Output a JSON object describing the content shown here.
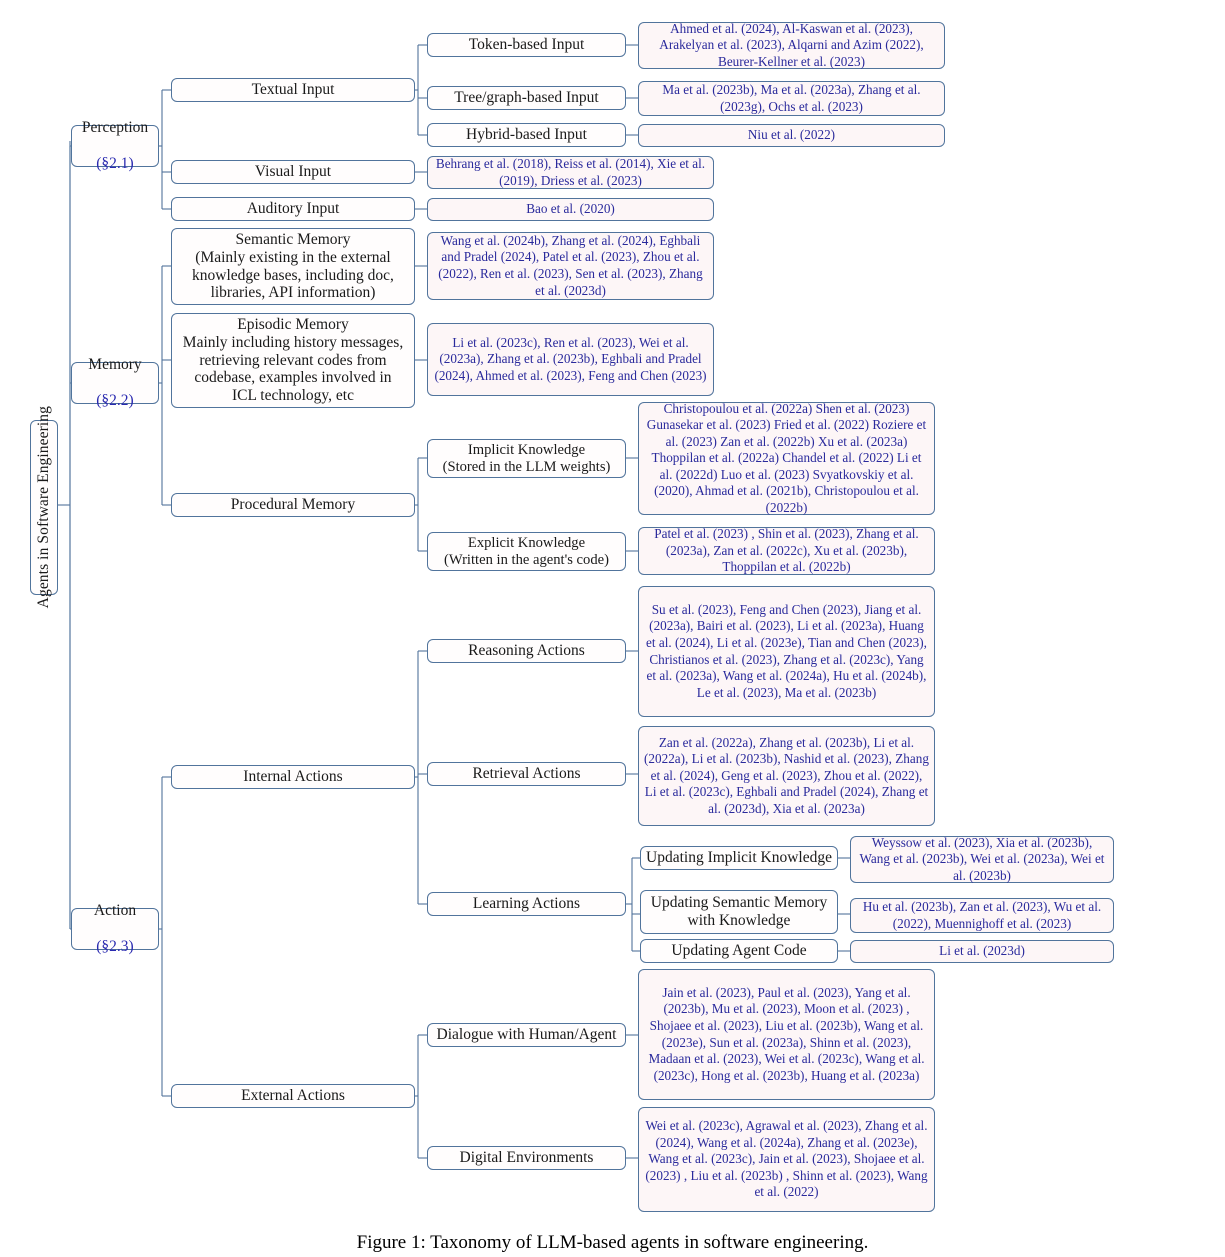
{
  "figure": {
    "caption": "Figure 1: Taxonomy of LLM-based agents in software engineering.",
    "root_label": "Agents in Software Engineering",
    "colors": {
      "box_border": "#51749c",
      "citation_text": "#2a2a9c",
      "citation_bg": "#fdf6f7",
      "section_ref": "#2a2ab0",
      "label_text": "#1a1a1a"
    }
  },
  "branches": {
    "perception": {
      "title": "Perception",
      "section": "(§2.1)",
      "children": {
        "textual_input": {
          "label": "Textual Input",
          "children": {
            "token_based": {
              "label": "Token-based Input",
              "citations": "Ahmed et al. (2024), Al-Kaswan et al. (2023), Arakelyan et al. (2023),  Alqarni and Azim (2022), Beurer-Kellner et al. (2023)"
            },
            "tree_graph_based": {
              "label": "Tree/graph-based Input",
              "citations": "Ma et al. (2023b),  Ma et al. (2023a), Zhang et al. (2023g), Ochs et al. (2023)"
            },
            "hybrid_based": {
              "label": "Hybrid-based Input",
              "citations": "Niu et al. (2022)"
            }
          }
        },
        "visual_input": {
          "label": "Visual Input",
          "citations": "Behrang et al. (2018), Reiss et al. (2014), Xie et al. (2019), Driess et al. (2023)"
        },
        "auditory_input": {
          "label": "Auditory Input",
          "citations": "Bao et al. (2020)"
        }
      }
    },
    "memory": {
      "title": "Memory",
      "section": "(§2.2)",
      "children": {
        "semantic_memory": {
          "label": "Semantic Memory\n(Mainly existing in the external\nknowledge bases, including doc,\nlibraries, API information)",
          "citations": "Wang et al. (2024b), Zhang et al. (2024), Eghbali and Pradel (2024), Patel et al. (2023), Zhou et al. (2022), Ren et al. (2023), Sen et al. (2023), Zhang et al. (2023d)"
        },
        "episodic_memory": {
          "label": "Episodic Memory\nMainly including history messages,\nretrieving relevant codes from\ncodebase, examples involved in\nICL technology, etc",
          "citations": "Li et al. (2023c), Ren et al. (2023), Wei et al. (2023a), Zhang et al. (2023b), Eghbali and Pradel (2024), Ahmed et al. (2023), Feng and Chen (2023)"
        },
        "procedural_memory": {
          "label": "Procedural Memory",
          "children": {
            "implicit_knowledge": {
              "label": "Implicit Knowledge\n(Stored in the LLM weights)",
              "citations": "Christopoulou et al. (2022a) Shen et al. (2023) Gunasekar et al. (2023) Fried et al. (2022) Roziere et al. (2023) Zan et al. (2022b) Xu et al. (2023a) Thoppilan et al. (2022a) Chandel et al. (2022) Li et al. (2022d) Luo et al. (2023) Svyatkovskiy et al. (2020), Ahmad et al. (2021b), Christopoulou et al. (2022b)"
            },
            "explicit_knowledge": {
              "label": "Explicit Knowledge\n(Written in the agent's code)",
              "citations": "Patel et al. (2023) , Shin et al. (2023), Zhang et al. (2023a), Zan et al. (2022c), Xu et al. (2023b), Thoppilan et al. (2022b)"
            }
          }
        }
      }
    },
    "action": {
      "title": "Action",
      "section": "(§2.3)",
      "children": {
        "internal_actions": {
          "label": "Internal Actions",
          "children": {
            "reasoning_actions": {
              "label": "Reasoning Actions",
              "citations": "Su et al. (2023), Feng and Chen (2023), Jiang et al. (2023a), Bairi et al. (2023), Li et al. (2023a), Huang et al. (2024), Li et al. (2023e), Tian and Chen (2023), Christianos et al. (2023), Zhang et al. (2023c), Yang et al. (2023a), Wang et al. (2024a), Hu et al. (2024b), Le et al. (2023), Ma et al. (2023b)"
            },
            "retrieval_actions": {
              "label": "Retrieval Actions",
              "citations": "Zan et al. (2022a), Zhang et al. (2023b), Li et al. (2022a), Li et al. (2023b), Nashid et al. (2023), Zhang et al. (2024), Geng et al. (2023), Zhou et al. (2022), Li et al. (2023c), Eghbali and Pradel (2024), Zhang et al. (2023d), Xia et al. (2023a)"
            },
            "learning_actions": {
              "label": "Learning Actions",
              "children": {
                "updating_implicit_knowledge": {
                  "label": "Updating Implicit Knowledge",
                  "citations": "Weyssow et al. (2023), Xia et al. (2023b), Wang et al. (2023b), Wei et al. (2023a), Wei et al. (2023b)"
                },
                "updating_semantic_memory": {
                  "label": "Updating Semantic Memory\nwith Knowledge",
                  "citations": "Hu et al. (2023b), Zan et al. (2023), Wu et al. (2022), Muennighoff et al. (2023)"
                },
                "updating_agent_code": {
                  "label": "Updating Agent Code",
                  "citations": "Li et al. (2023d)"
                }
              }
            }
          }
        },
        "external_actions": {
          "label": "External Actions",
          "children": {
            "dialogue": {
              "label": "Dialogue with Human/Agent",
              "citations": "Jain et al. (2023), Paul et al. (2023), Yang et al. (2023b), Mu et al. (2023), Moon et al. (2023) , Shojaee et al. (2023), Liu et al. (2023b), Wang et al. (2023e), Sun et al. (2023a), Shinn et al. (2023), Madaan et al. (2023), Wei et al. (2023c), Wang et al. (2023c), Hong et al. (2023b), Huang et al. (2023a)"
            },
            "digital_environments": {
              "label": "Digital Environments",
              "citations": "Wei et al. (2023c), Agrawal et al. (2023), Zhang et al. (2024), Wang et al. (2024a), Zhang et al. (2023e), Wang et al. (2023c), Jain et al. (2023), Shojaee et al. (2023) , Liu et al. (2023b) , Shinn et al. (2023), Wang et al. (2022)"
            }
          }
        }
      }
    }
  }
}
